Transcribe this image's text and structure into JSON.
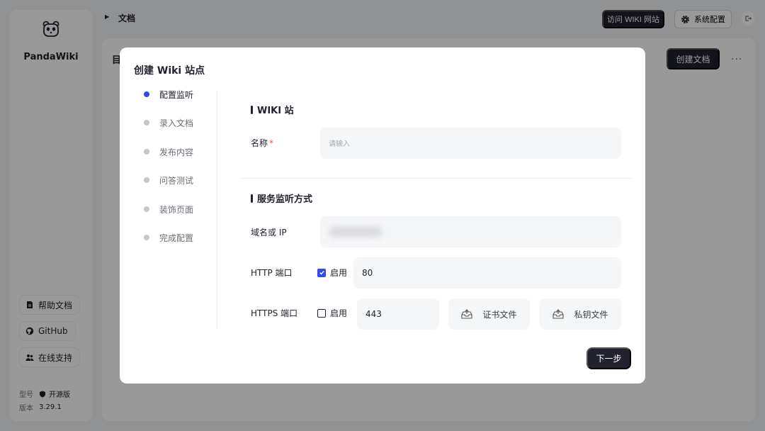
{
  "app": {
    "name": "PandaWiki",
    "breadcrumb": "文档",
    "visit_wiki_button": "访问 WIKI 网站",
    "settings_button": "系统配置",
    "main_title": "目",
    "create_doc_button": "创建文档",
    "more_icon": "···"
  },
  "sidebar": {
    "links": [
      {
        "label": "帮助文档",
        "icon": "doc-icon"
      },
      {
        "label": "GitHub",
        "icon": "github-icon"
      },
      {
        "label": "在线支持",
        "icon": "people-icon"
      }
    ],
    "model_label": "型号",
    "model_value": "开源版",
    "version_label": "版本",
    "version_value": "3.29.1"
  },
  "modal": {
    "title": "创建 Wiki 站点",
    "steps": [
      {
        "label": "配置监听",
        "active": true
      },
      {
        "label": "录入文档",
        "active": false
      },
      {
        "label": "发布内容",
        "active": false
      },
      {
        "label": "问答测试",
        "active": false
      },
      {
        "label": "装饰页面",
        "active": false
      },
      {
        "label": "完成配置",
        "active": false
      }
    ],
    "wiki_section_title": "WIKI 站",
    "name_label": "名称",
    "name_required_mark": "*",
    "name_placeholder": "请输入",
    "service_section_title": "服务监听方式",
    "domain_label": "域名或 IP",
    "http_label": "HTTP 端口",
    "http_enable_label": "启用",
    "http_enabled": true,
    "http_port": "80",
    "https_label": "HTTPS 端口",
    "https_enable_label": "启用",
    "https_enabled": false,
    "https_port": "443",
    "cert_file_button": "证书文件",
    "key_file_button": "私钥文件",
    "next_button": "下一步"
  },
  "colors": {
    "accent": "#3248f2",
    "dark": "#21222d",
    "required": "#f64e54"
  }
}
